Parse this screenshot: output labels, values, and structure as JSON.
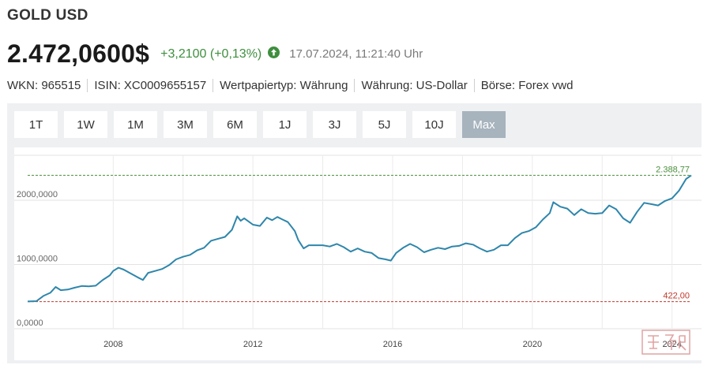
{
  "header": {
    "title": "GOLD USD",
    "price": "2.472,0600$",
    "change": "+3,2100 (+0,13%)",
    "timestamp": "17.07.2024, 11:21:40 Uhr",
    "up_icon": "arrow-up-circle-icon"
  },
  "meta": [
    "WKN: 965515",
    "ISIN: XC0009655157",
    "Wertpapiertyp: Währung",
    "Währung: US-Dollar",
    "Börse: Forex vwd"
  ],
  "ranges": [
    "1T",
    "1W",
    "1M",
    "3M",
    "6M",
    "1J",
    "3J",
    "5J",
    "10J",
    "Max"
  ],
  "active_range": "Max",
  "colors": {
    "line": "#2e86ab",
    "high": "#4a8f3c",
    "low": "#c0392b",
    "positive": "#3e8e3e",
    "active_button": "#a7b3bd"
  },
  "chart_data": {
    "type": "line",
    "x_range": [
      2005.55,
      2024.55
    ],
    "ylim": [
      0,
      2700
    ],
    "yticks": [
      {
        "value": 0,
        "label": "0,0000"
      },
      {
        "value": 1000,
        "label": "1000,0000"
      },
      {
        "value": 2000,
        "label": "2000,0000"
      }
    ],
    "xticks": [
      {
        "value": 2008,
        "label": "2008"
      },
      {
        "value": 2012,
        "label": "2012"
      },
      {
        "value": 2016,
        "label": "2016"
      },
      {
        "value": 2020,
        "label": "2020"
      },
      {
        "value": 2024,
        "label": "2024"
      }
    ],
    "reference_lines": [
      {
        "value": 2388.77,
        "label": "2.388,77",
        "kind": "high"
      },
      {
        "value": 422.0,
        "label": "422,00",
        "kind": "low"
      }
    ],
    "series": [
      {
        "x": [
          2005.55,
          2005.8,
          2006.0,
          2006.2,
          2006.35,
          2006.5,
          2006.7,
          2006.9,
          2007.1,
          2007.3,
          2007.5,
          2007.7,
          2007.9,
          2008.0,
          2008.15,
          2008.3,
          2008.5,
          2008.7,
          2008.85,
          2009.0,
          2009.2,
          2009.4,
          2009.6,
          2009.8,
          2010.0,
          2010.2,
          2010.4,
          2010.6,
          2010.8,
          2011.0,
          2011.2,
          2011.4,
          2011.55,
          2011.65,
          2011.75,
          2011.9,
          2012.0,
          2012.2,
          2012.4,
          2012.55,
          2012.7,
          2012.85,
          2013.0,
          2013.2,
          2013.3,
          2013.45,
          2013.6,
          2013.8,
          2014.0,
          2014.2,
          2014.4,
          2014.6,
          2014.8,
          2015.0,
          2015.2,
          2015.4,
          2015.6,
          2015.8,
          2015.95,
          2016.1,
          2016.3,
          2016.5,
          2016.7,
          2016.9,
          2017.1,
          2017.3,
          2017.5,
          2017.7,
          2017.9,
          2018.1,
          2018.3,
          2018.5,
          2018.7,
          2018.9,
          2019.1,
          2019.3,
          2019.5,
          2019.7,
          2019.9,
          2020.1,
          2020.3,
          2020.5,
          2020.6,
          2020.8,
          2021.0,
          2021.2,
          2021.4,
          2021.6,
          2021.8,
          2022.0,
          2022.2,
          2022.4,
          2022.6,
          2022.8,
          2023.0,
          2023.2,
          2023.4,
          2023.6,
          2023.8,
          2024.0,
          2024.2,
          2024.4,
          2024.55
        ],
        "y": [
          425,
          430,
          510,
          560,
          650,
          600,
          610,
          640,
          665,
          660,
          670,
          760,
          830,
          900,
          950,
          920,
          860,
          800,
          760,
          870,
          900,
          930,
          990,
          1080,
          1120,
          1150,
          1220,
          1260,
          1370,
          1400,
          1430,
          1540,
          1750,
          1680,
          1720,
          1660,
          1620,
          1600,
          1730,
          1690,
          1740,
          1700,
          1660,
          1520,
          1380,
          1250,
          1300,
          1300,
          1300,
          1280,
          1320,
          1270,
          1200,
          1250,
          1200,
          1180,
          1100,
          1080,
          1060,
          1180,
          1260,
          1320,
          1270,
          1190,
          1230,
          1260,
          1240,
          1280,
          1290,
          1330,
          1310,
          1250,
          1200,
          1230,
          1300,
          1300,
          1410,
          1490,
          1520,
          1580,
          1700,
          1800,
          1970,
          1900,
          1870,
          1770,
          1860,
          1800,
          1790,
          1800,
          1920,
          1860,
          1720,
          1650,
          1820,
          1960,
          1940,
          1920,
          1990,
          2030,
          2150,
          2330,
          2388.77
        ]
      }
    ]
  }
}
